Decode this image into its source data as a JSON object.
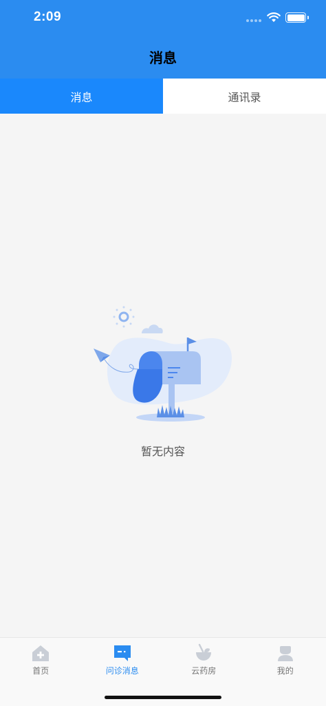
{
  "status_bar": {
    "time": "2:09"
  },
  "header": {
    "title": "消息"
  },
  "tabs": [
    {
      "label": "消息",
      "active": true
    },
    {
      "label": "通讯录",
      "active": false
    }
  ],
  "empty_state": {
    "text": "暂无内容"
  },
  "tab_bar": {
    "items": [
      {
        "label": "首页",
        "icon": "home-icon",
        "active": false
      },
      {
        "label": "问诊消息",
        "icon": "chat-icon",
        "active": true
      },
      {
        "label": "云药房",
        "icon": "pharmacy-icon",
        "active": false
      },
      {
        "label": "我的",
        "icon": "profile-icon",
        "active": false
      }
    ]
  },
  "colors": {
    "primary": "#2b8cf0",
    "tab_active": "#1a88fc",
    "background": "#f5f5f5"
  }
}
